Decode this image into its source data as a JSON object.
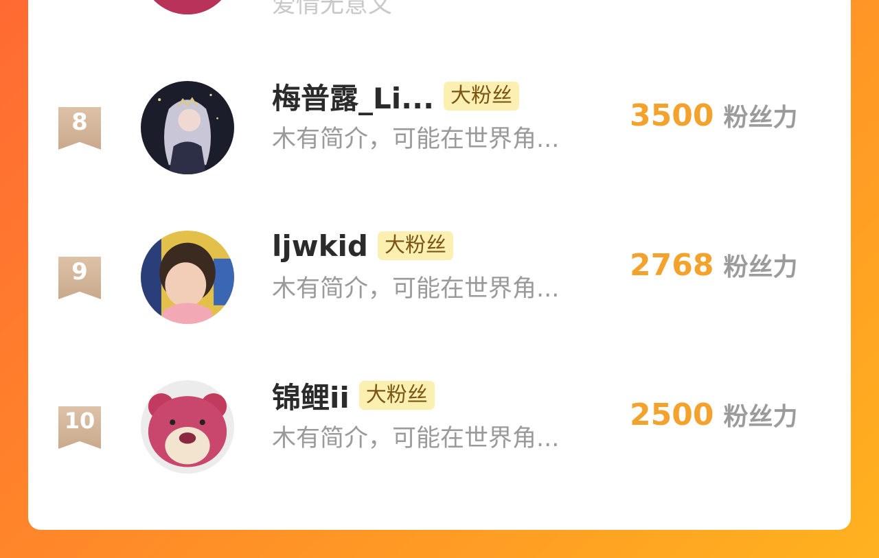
{
  "partial_row": {
    "bio": "爱情无意义"
  },
  "rows": [
    {
      "rank": "8",
      "name": "梅普露_Li...",
      "badge": "大粉丝",
      "bio": "木有简介，可能在世界角...",
      "score": "3500",
      "unit": "粉丝力",
      "avatar_icon": "girl-illustration-avatar"
    },
    {
      "rank": "9",
      "name": "ljwkid",
      "badge": "大粉丝",
      "bio": "木有简介，可能在世界角...",
      "score": "2768",
      "unit": "粉丝力",
      "avatar_icon": "toddler-photo-avatar"
    },
    {
      "rank": "10",
      "name": "锦鲤ii",
      "badge": "大粉丝",
      "bio": "木有简介，可能在世界角...",
      "score": "2500",
      "unit": "粉丝力",
      "avatar_icon": "pink-bear-avatar"
    }
  ],
  "colors": {
    "accent_score": "#f2a22d",
    "badge_bg": "#fbefb2",
    "rank_ribbon": "#d6b79c"
  }
}
